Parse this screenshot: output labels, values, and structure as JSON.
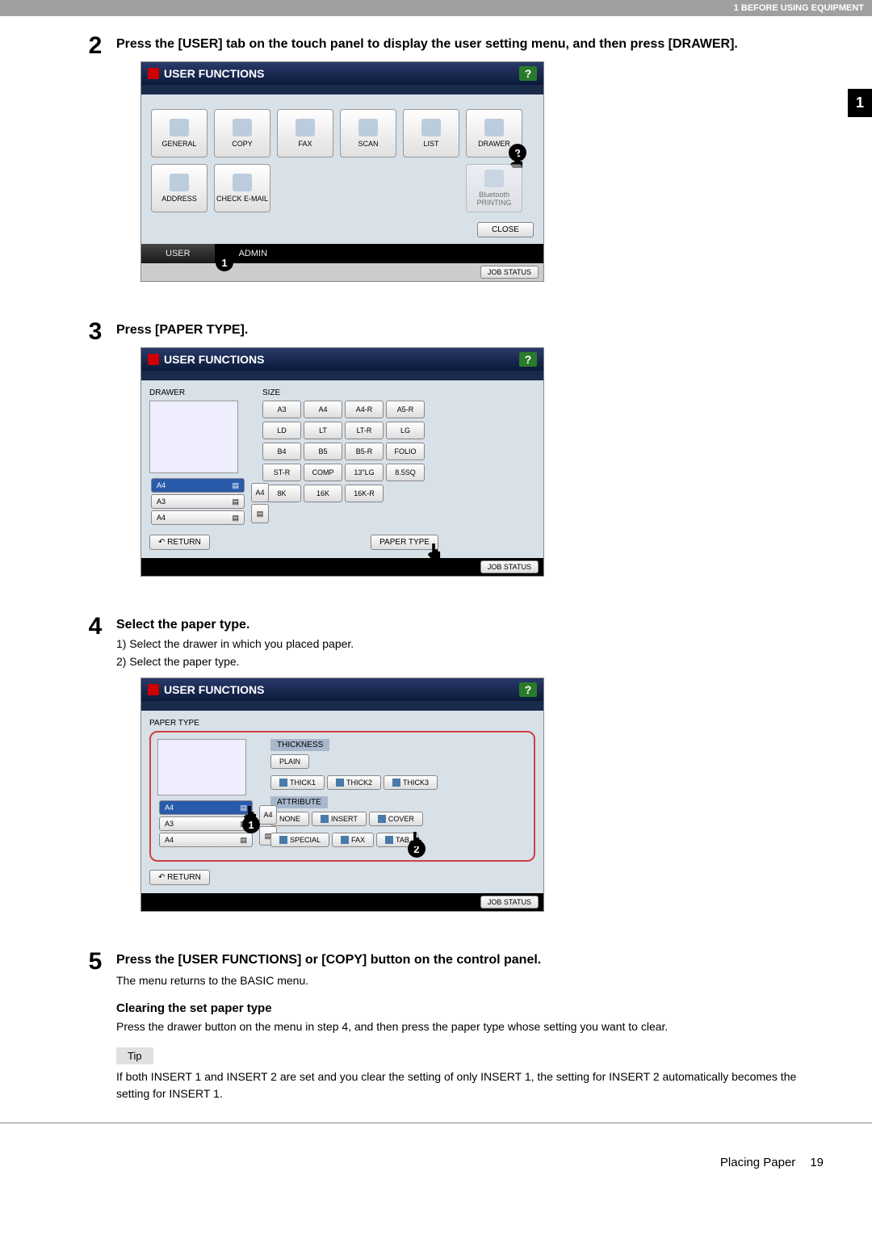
{
  "header": {
    "chapter": "1 BEFORE USING EQUIPMENT",
    "side": "1"
  },
  "step2": {
    "num": "2",
    "title": "Press the [USER] tab on the touch panel to display the user setting menu, and then press [DRAWER].",
    "panel_title": "USER FUNCTIONS",
    "func": {
      "general": "GENERAL",
      "copy": "COPY",
      "fax": "FAX",
      "scan": "SCAN",
      "list": "LIST",
      "drawer": "DRAWER",
      "address": "ADDRESS",
      "check_email": "CHECK E-MAIL",
      "bt": "Bluetooth PRINTING"
    },
    "close": "CLOSE",
    "tab_user": "USER",
    "tab_admin": "ADMIN",
    "jobstatus": "JOB STATUS",
    "badge1": "1",
    "badge2": "2"
  },
  "step3": {
    "num": "3",
    "title": "Press [PAPER TYPE].",
    "panel_title": "USER FUNCTIONS",
    "drawer_label": "DRAWER",
    "size_label": "SIZE",
    "slots": {
      "a4a": "A4",
      "a3": "A3",
      "a4b": "A4",
      "side": "A4"
    },
    "sizes": [
      [
        "A3",
        "A4",
        "A4-R",
        "A5-R"
      ],
      [
        "LD",
        "LT",
        "LT-R",
        "LG"
      ],
      [
        "B4",
        "B5",
        "B5-R",
        "FOLIO"
      ],
      [
        "ST-R",
        "COMP",
        "13\"LG",
        "8.5SQ"
      ],
      [
        "8K",
        "16K",
        "16K-R"
      ]
    ],
    "return": "RETURN",
    "papertype_btn": "PAPER TYPE",
    "jobstatus": "JOB STATUS"
  },
  "step4": {
    "num": "4",
    "title": "Select the paper type.",
    "sub1": "1)  Select the drawer in which you placed paper.",
    "sub2": "2)  Select the paper type.",
    "panel_title": "USER FUNCTIONS",
    "pt_label": "PAPER TYPE",
    "slots": {
      "a4a": "A4",
      "a3": "A3",
      "a4b": "A4",
      "side": "A4"
    },
    "thickness_label": "THICKNESS",
    "thickness": [
      "PLAIN",
      "THICK1",
      "THICK2",
      "THICK3"
    ],
    "attribute_label": "ATTRIBUTE",
    "attribute": [
      "NONE",
      "INSERT",
      "COVER",
      "SPECIAL",
      "FAX",
      "TAB"
    ],
    "return": "RETURN",
    "jobstatus": "JOB STATUS",
    "badge1": "1",
    "badge2": "2"
  },
  "step5": {
    "num": "5",
    "title": "Press the [USER FUNCTIONS] or [COPY] button on the control panel.",
    "text": "The menu returns to the BASIC menu."
  },
  "clearing": {
    "heading": "Clearing the set paper type",
    "text": "Press the drawer button on the menu in step 4, and then press the paper type whose setting you want to clear."
  },
  "tip": {
    "label": "Tip",
    "text": "If both INSERT 1 and INSERT 2 are set and you clear the setting of only INSERT 1, the setting for INSERT 2 automatically becomes the setting for INSERT 1."
  },
  "footer": {
    "section": "Placing Paper",
    "page": "19"
  }
}
